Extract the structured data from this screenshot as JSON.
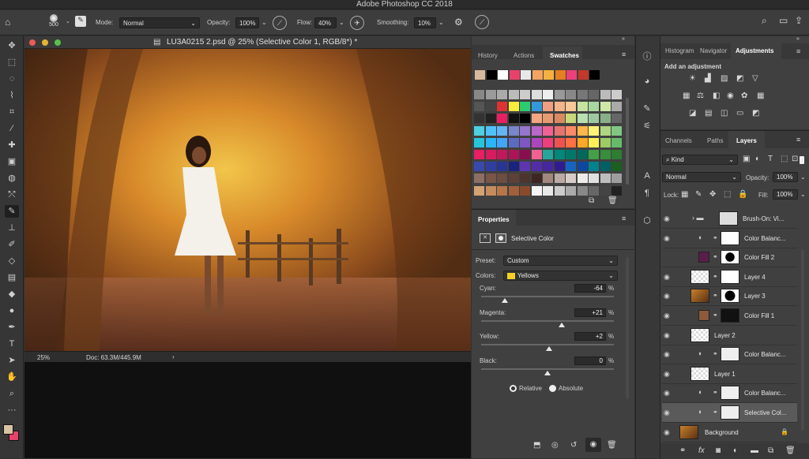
{
  "app_title": "Adobe Photoshop CC 2018",
  "options": {
    "brush_size": "500",
    "mode_label": "Mode:",
    "mode_value": "Normal",
    "opacity_label": "Opacity:",
    "opacity_value": "100%",
    "flow_label": "Flow:",
    "flow_value": "40%",
    "smoothing_label": "Smoothing:",
    "smoothing_value": "10%"
  },
  "document": {
    "tab_title": "LU3A0215 2.psd @ 25% (Selective Color 1, RGB/8*) *",
    "zoom": "25%",
    "doc_info": "Doc: 63.3M/445.9M"
  },
  "swatches_panel": {
    "tabs": [
      "History",
      "Actions",
      "Swatches"
    ],
    "selected_tab": "Swatches"
  },
  "properties_panel": {
    "title": "Properties",
    "adjustment_name": "Selective Color",
    "preset_label": "Preset:",
    "preset_value": "Custom",
    "colors_label": "Colors:",
    "colors_value": "Yellows",
    "sliders": [
      {
        "label": "Cyan:",
        "value": "-64",
        "unit": "%",
        "level": -64
      },
      {
        "label": "Magenta:",
        "value": "+21",
        "unit": "%",
        "level": 21
      },
      {
        "label": "Yellow:",
        "value": "+2",
        "unit": "%",
        "level": 2
      },
      {
        "label": "Black:",
        "value": "0",
        "unit": "%",
        "level": 0
      }
    ],
    "mode_relative": "Relative",
    "mode_absolute": "Absolute"
  },
  "adjustments_panel": {
    "tabs": [
      "Histogram",
      "Navigator",
      "Adjustments"
    ],
    "hint": "Add an adjustment"
  },
  "layers_panel": {
    "tabs": [
      "Channels",
      "Paths",
      "Layers"
    ],
    "filter_value": "Kind",
    "blend_mode": "Normal",
    "opacity_label": "Opacity:",
    "opacity_value": "100%",
    "lock_label": "Lock:",
    "fill_label": "Fill:",
    "fill_value": "100%",
    "layers": [
      {
        "name": "Brush-On: Vi...",
        "visible": true
      },
      {
        "name": "Color Balanc...",
        "visible": true
      },
      {
        "name": "Color Fill 2",
        "visible": false
      },
      {
        "name": "Layer 4",
        "visible": true
      },
      {
        "name": "Layer 3",
        "visible": true
      },
      {
        "name": "Color Fill 1",
        "visible": true
      },
      {
        "name": "Layer 2",
        "visible": true
      },
      {
        "name": "Color Balanc...",
        "visible": true
      },
      {
        "name": "Layer 1",
        "visible": true
      },
      {
        "name": "Color Balanc...",
        "visible": true
      },
      {
        "name": "Selective Col...",
        "visible": true
      },
      {
        "name": "Background",
        "visible": true
      }
    ]
  },
  "colors": {
    "accent_selected": "#5a5a5a",
    "panel_bg": "#404040",
    "foreground_color": "#d8c3a4",
    "background_color": "#e8426a"
  }
}
